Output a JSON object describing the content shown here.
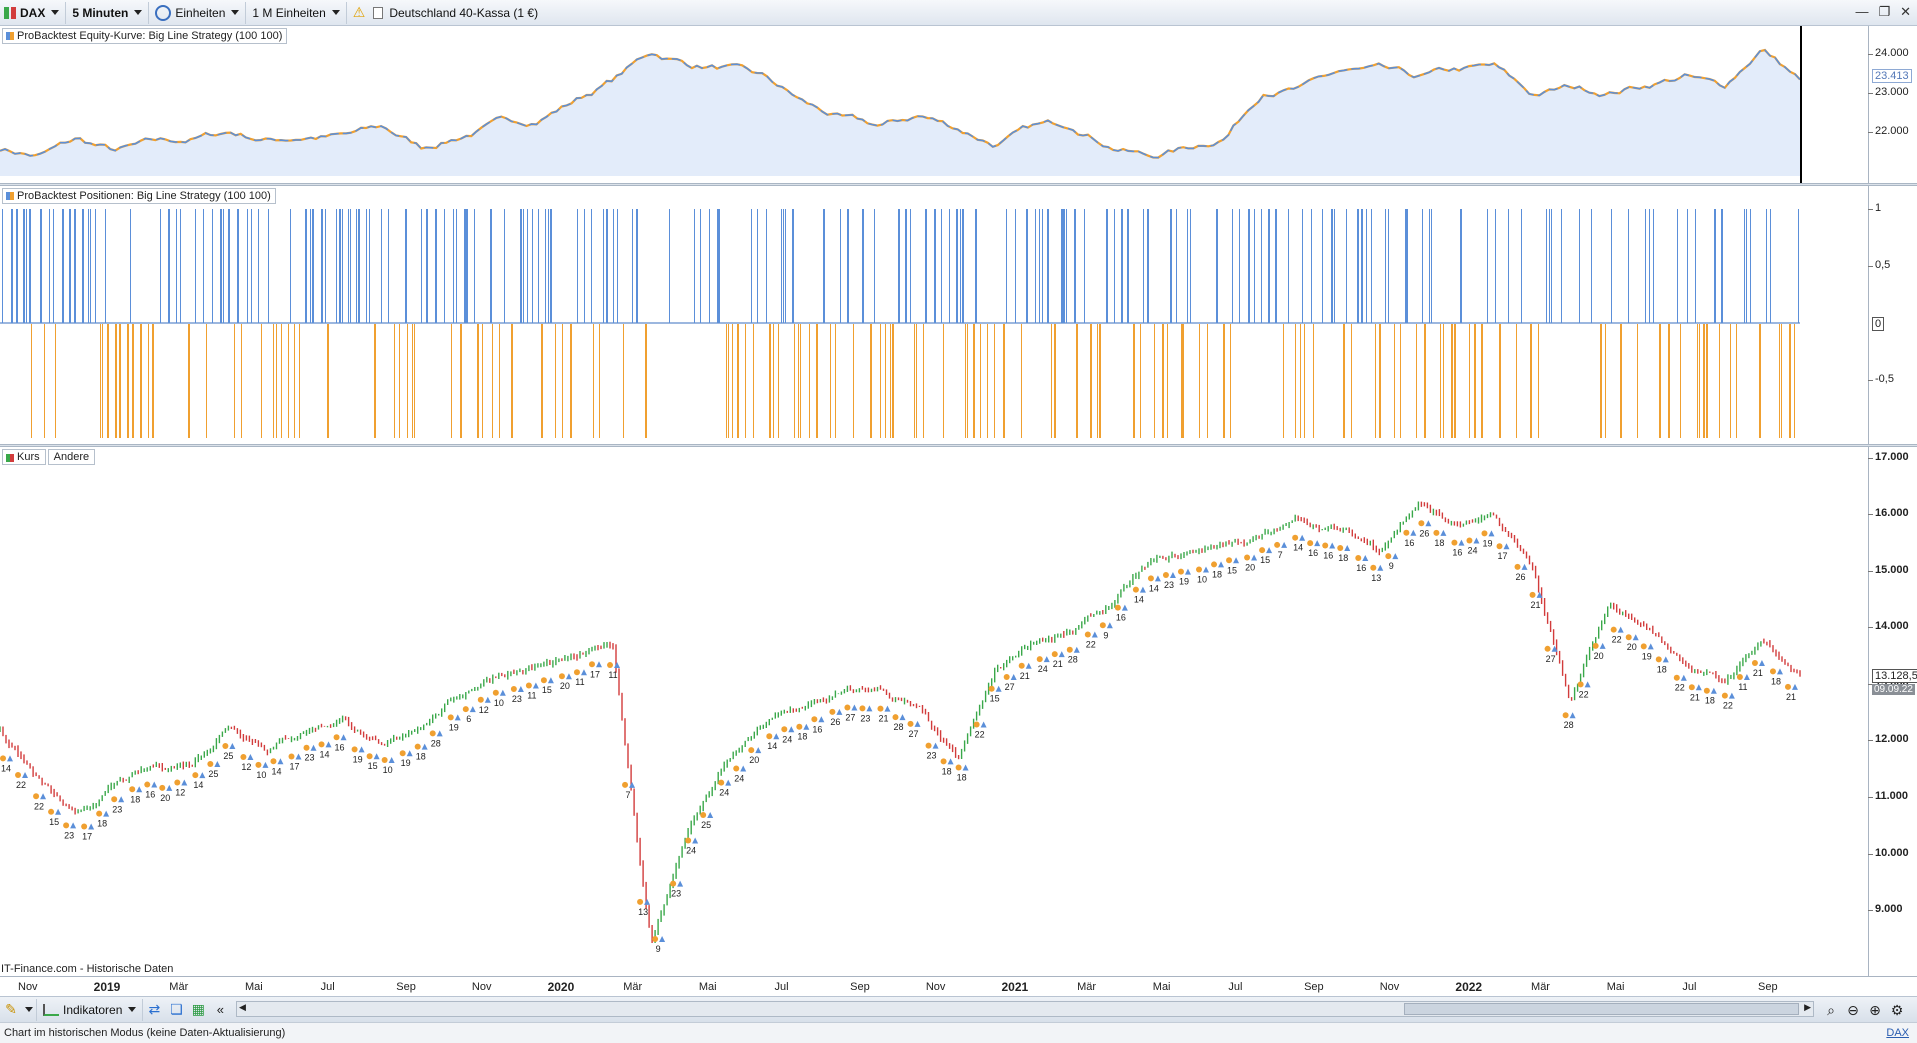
{
  "toolbar": {
    "symbol": "DAX",
    "interval": "5 Minuten",
    "units": "Einheiten",
    "units_size": "1 M Einheiten",
    "instrument": "Deutschland 40-Kassa (1 €)"
  },
  "equity_panel": {
    "title": "ProBacktest Equity-Kurve: Big Line Strategy (100 100)",
    "axis_ticks": [
      "24.000",
      "23.000",
      "22.000"
    ],
    "current_value": "23.413"
  },
  "positions_panel": {
    "title": "ProBacktest Positionen: Big Line Strategy (100 100)",
    "axis_ticks": [
      "1",
      "0,5",
      "0",
      "-0,5"
    ]
  },
  "price_panel": {
    "tabs": [
      "Kurs",
      "Andere"
    ],
    "axis_ticks": [
      "17.000",
      "16.000",
      "15.000",
      "14.000",
      "13.000",
      "12.000",
      "11.000",
      "10.000",
      "9.000"
    ],
    "current_value": "13.128,5",
    "current_date": "09.09.22",
    "source": "IT-Finance.com - Historische Daten",
    "signal_labels": [
      "14",
      "22",
      "22",
      "15",
      "23",
      "17",
      "18",
      "23",
      "18",
      "16",
      "20",
      "12",
      "14",
      "25",
      "25",
      "12",
      "10",
      "14",
      "17",
      "23",
      "14",
      "16",
      "19",
      "15",
      "10",
      "19",
      "18",
      "28",
      "19",
      "6",
      "12",
      "10",
      "23",
      "11",
      "15",
      "20",
      "11",
      "17",
      "11",
      "7",
      "13",
      "9",
      "23",
      "24",
      "25",
      "24",
      "24",
      "20",
      "14",
      "24",
      "18",
      "16",
      "26",
      "27",
      "23",
      "21",
      "28",
      "27",
      "23",
      "18",
      "18",
      "22",
      "15",
      "27",
      "21",
      "24",
      "21",
      "28",
      "22",
      "9",
      "16",
      "14",
      "14",
      "23",
      "19",
      "10",
      "18",
      "15",
      "20",
      "15",
      "7",
      "14",
      "16",
      "16",
      "18",
      "16",
      "13",
      "9",
      "16",
      "26",
      "18",
      "16",
      "24",
      "19",
      "17",
      "26",
      "21",
      "27",
      "28",
      "22",
      "20",
      "22",
      "20",
      "19",
      "18",
      "22",
      "21",
      "18",
      "22",
      "11",
      "21",
      "18",
      "21"
    ]
  },
  "time_axis": {
    "labels": [
      "Nov",
      "2019",
      "Mär",
      "Mai",
      "Jul",
      "Sep",
      "Nov",
      "2020",
      "Mär",
      "Mai",
      "Jul",
      "Sep",
      "Nov",
      "2021",
      "Mär",
      "Mai",
      "Jul",
      "Sep",
      "Nov",
      "2022",
      "Mär",
      "Mai",
      "Jul",
      "Sep"
    ],
    "year_labels": [
      "2019",
      "2020",
      "2021",
      "2022"
    ]
  },
  "bottom_toolbar": {
    "indicators": "Indikatoren"
  },
  "status": {
    "text": "Chart im historischen Modus (keine Daten-Aktualisierung)",
    "symbol_link": "DAX"
  },
  "colors": {
    "equity_line": "#5b8fd9",
    "equity_fill": "#e3ecfa",
    "long_bar": "#5b8fd9",
    "short_bar": "#f0a030",
    "candle_up": "#3aa84a",
    "candle_down": "#d23c3c"
  },
  "chart_data": [
    {
      "type": "area",
      "title": "ProBacktest Equity-Kurve: Big Line Strategy (100 100)",
      "ylim": [
        21000,
        24600
      ],
      "x": [
        "2018-10",
        "2018-11",
        "2018-12",
        "2019-01",
        "2019-02",
        "2019-03",
        "2019-04",
        "2019-05",
        "2019-06",
        "2019-07",
        "2019-08",
        "2019-09",
        "2019-10",
        "2019-11",
        "2019-12",
        "2020-01",
        "2020-02",
        "2020-03",
        "2020-04",
        "2020-05",
        "2020-06",
        "2020-07",
        "2020-08",
        "2020-09",
        "2020-10",
        "2020-11",
        "2020-12",
        "2021-01",
        "2021-02",
        "2021-03",
        "2021-04",
        "2021-05",
        "2021-06",
        "2021-07",
        "2021-08",
        "2021-09",
        "2021-10",
        "2021-11",
        "2021-12",
        "2022-01",
        "2022-02",
        "2022-03",
        "2022-04",
        "2022-05",
        "2022-06",
        "2022-07",
        "2022-08",
        "2022-09"
      ],
      "values": [
        21700,
        21500,
        21900,
        21600,
        21800,
        21900,
        22100,
        21900,
        22000,
        22000,
        22200,
        21700,
        22000,
        22300,
        22400,
        22900,
        23400,
        24100,
        23800,
        23700,
        23400,
        22800,
        22400,
        22200,
        22500,
        22200,
        21800,
        22200,
        22300,
        21800,
        21500,
        21700,
        22000,
        23200,
        23200,
        23600,
        23600,
        23400,
        23600,
        23700,
        23000,
        23200,
        23100,
        23300,
        23500,
        23200,
        24200,
        23413
      ]
    },
    {
      "type": "bar",
      "title": "ProBacktest Positionen: Big Line Strategy (100 100)",
      "ylim": [
        -1,
        1
      ],
      "series": [
        {
          "name": "Long",
          "value": 1
        },
        {
          "name": "Short",
          "value": -1
        }
      ]
    },
    {
      "type": "line",
      "title": "Kurs",
      "ylim": [
        8100,
        17100
      ],
      "x": [
        "2018-10",
        "2018-11",
        "2018-12",
        "2019-01",
        "2019-02",
        "2019-03",
        "2019-04",
        "2019-05",
        "2019-06",
        "2019-07",
        "2019-08",
        "2019-09",
        "2019-10",
        "2019-11",
        "2019-12",
        "2020-01",
        "2020-02",
        "2020-03",
        "2020-04",
        "2020-05",
        "2020-06",
        "2020-07",
        "2020-08",
        "2020-09",
        "2020-10",
        "2020-11",
        "2020-12",
        "2021-01",
        "2021-02",
        "2021-03",
        "2021-04",
        "2021-05",
        "2021-06",
        "2021-07",
        "2021-08",
        "2021-09",
        "2021-10",
        "2021-11",
        "2021-12",
        "2022-01",
        "2022-02",
        "2022-03",
        "2022-04",
        "2022-05",
        "2022-06",
        "2022-07",
        "2022-08",
        "2022-09"
      ],
      "values": [
        12200,
        11300,
        10600,
        11200,
        11500,
        11600,
        12300,
        11900,
        12200,
        12400,
        11800,
        12300,
        12800,
        13200,
        13300,
        13400,
        13700,
        8400,
        10500,
        11600,
        12300,
        12600,
        12800,
        12900,
        12500,
        11600,
        13200,
        13800,
        13900,
        14400,
        15100,
        15300,
        15500,
        15600,
        15900,
        15700,
        15400,
        16200,
        15800,
        15900,
        15100,
        12600,
        14400,
        14000,
        13400,
        13000,
        13800,
        13128.5
      ]
    }
  ]
}
